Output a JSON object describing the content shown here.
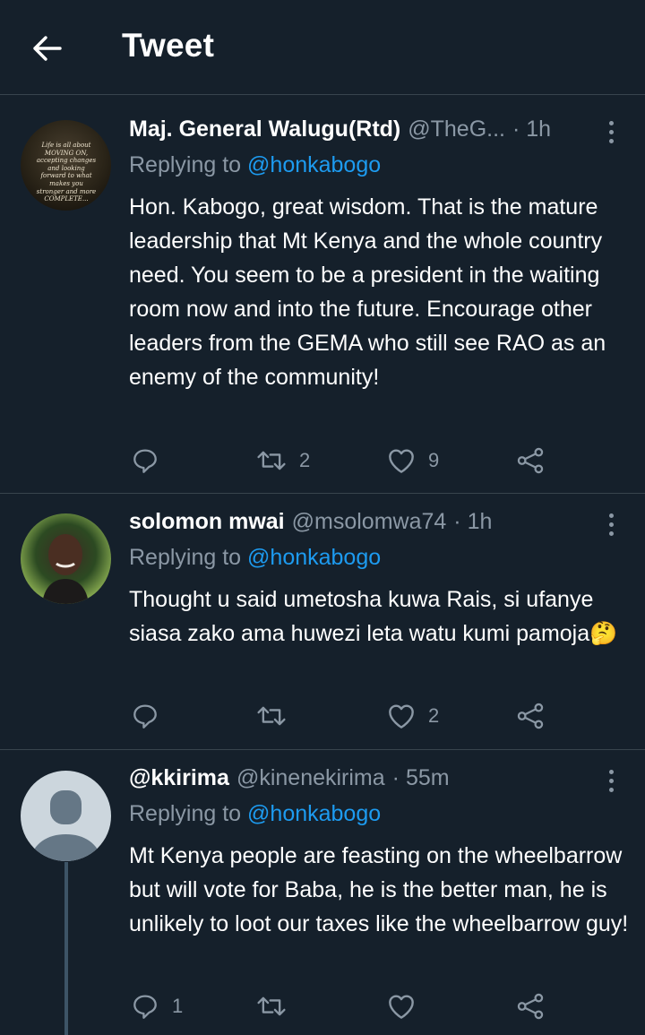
{
  "header": {
    "title": "Tweet"
  },
  "tweets": [
    {
      "name": "Maj. General Walugu(Rtd)",
      "handle": "@TheG...",
      "time": "· 1h",
      "replying_prefix": "Replying to",
      "replying_to": "@honkabogo",
      "text": "Hon. Kabogo, great wisdom. That is the mature leadership that Mt Kenya and the whole country need. You seem to be a president in the waiting room now and into the future. Encourage other leaders from the GEMA who still see RAO as an enemy of the community!",
      "avatar_text": "Life is all about MOVING ON, accepting changes and looking forward to what makes you stronger and more COMPLETE...",
      "replies": "",
      "retweets": "2",
      "likes": "9"
    },
    {
      "name": "solomon mwai",
      "handle": "@msolomwa74",
      "time": "· 1h",
      "replying_prefix": "Replying to",
      "replying_to": "@honkabogo",
      "text": "Thought u said umetosha kuwa Rais, si ufanye siasa zako ama huwezi leta watu kumi pamoja🤔",
      "replies": "",
      "retweets": "",
      "likes": "2"
    },
    {
      "name": "@kkirima",
      "handle": "@kinenekirima",
      "time": "· 55m",
      "replying_prefix": "Replying to",
      "replying_to": "@honkabogo",
      "text": "Mt Kenya people are feasting on the wheelbarrow but will vote for Baba, he is the better man, he is unlikely to loot our taxes like the wheelbarrow guy!",
      "replies": "1",
      "retweets": "",
      "likes": ""
    }
  ],
  "colors": {
    "background": "#15202b",
    "secondary_text": "#8b98a5",
    "link": "#1d9bf0",
    "divider": "#38444d"
  }
}
